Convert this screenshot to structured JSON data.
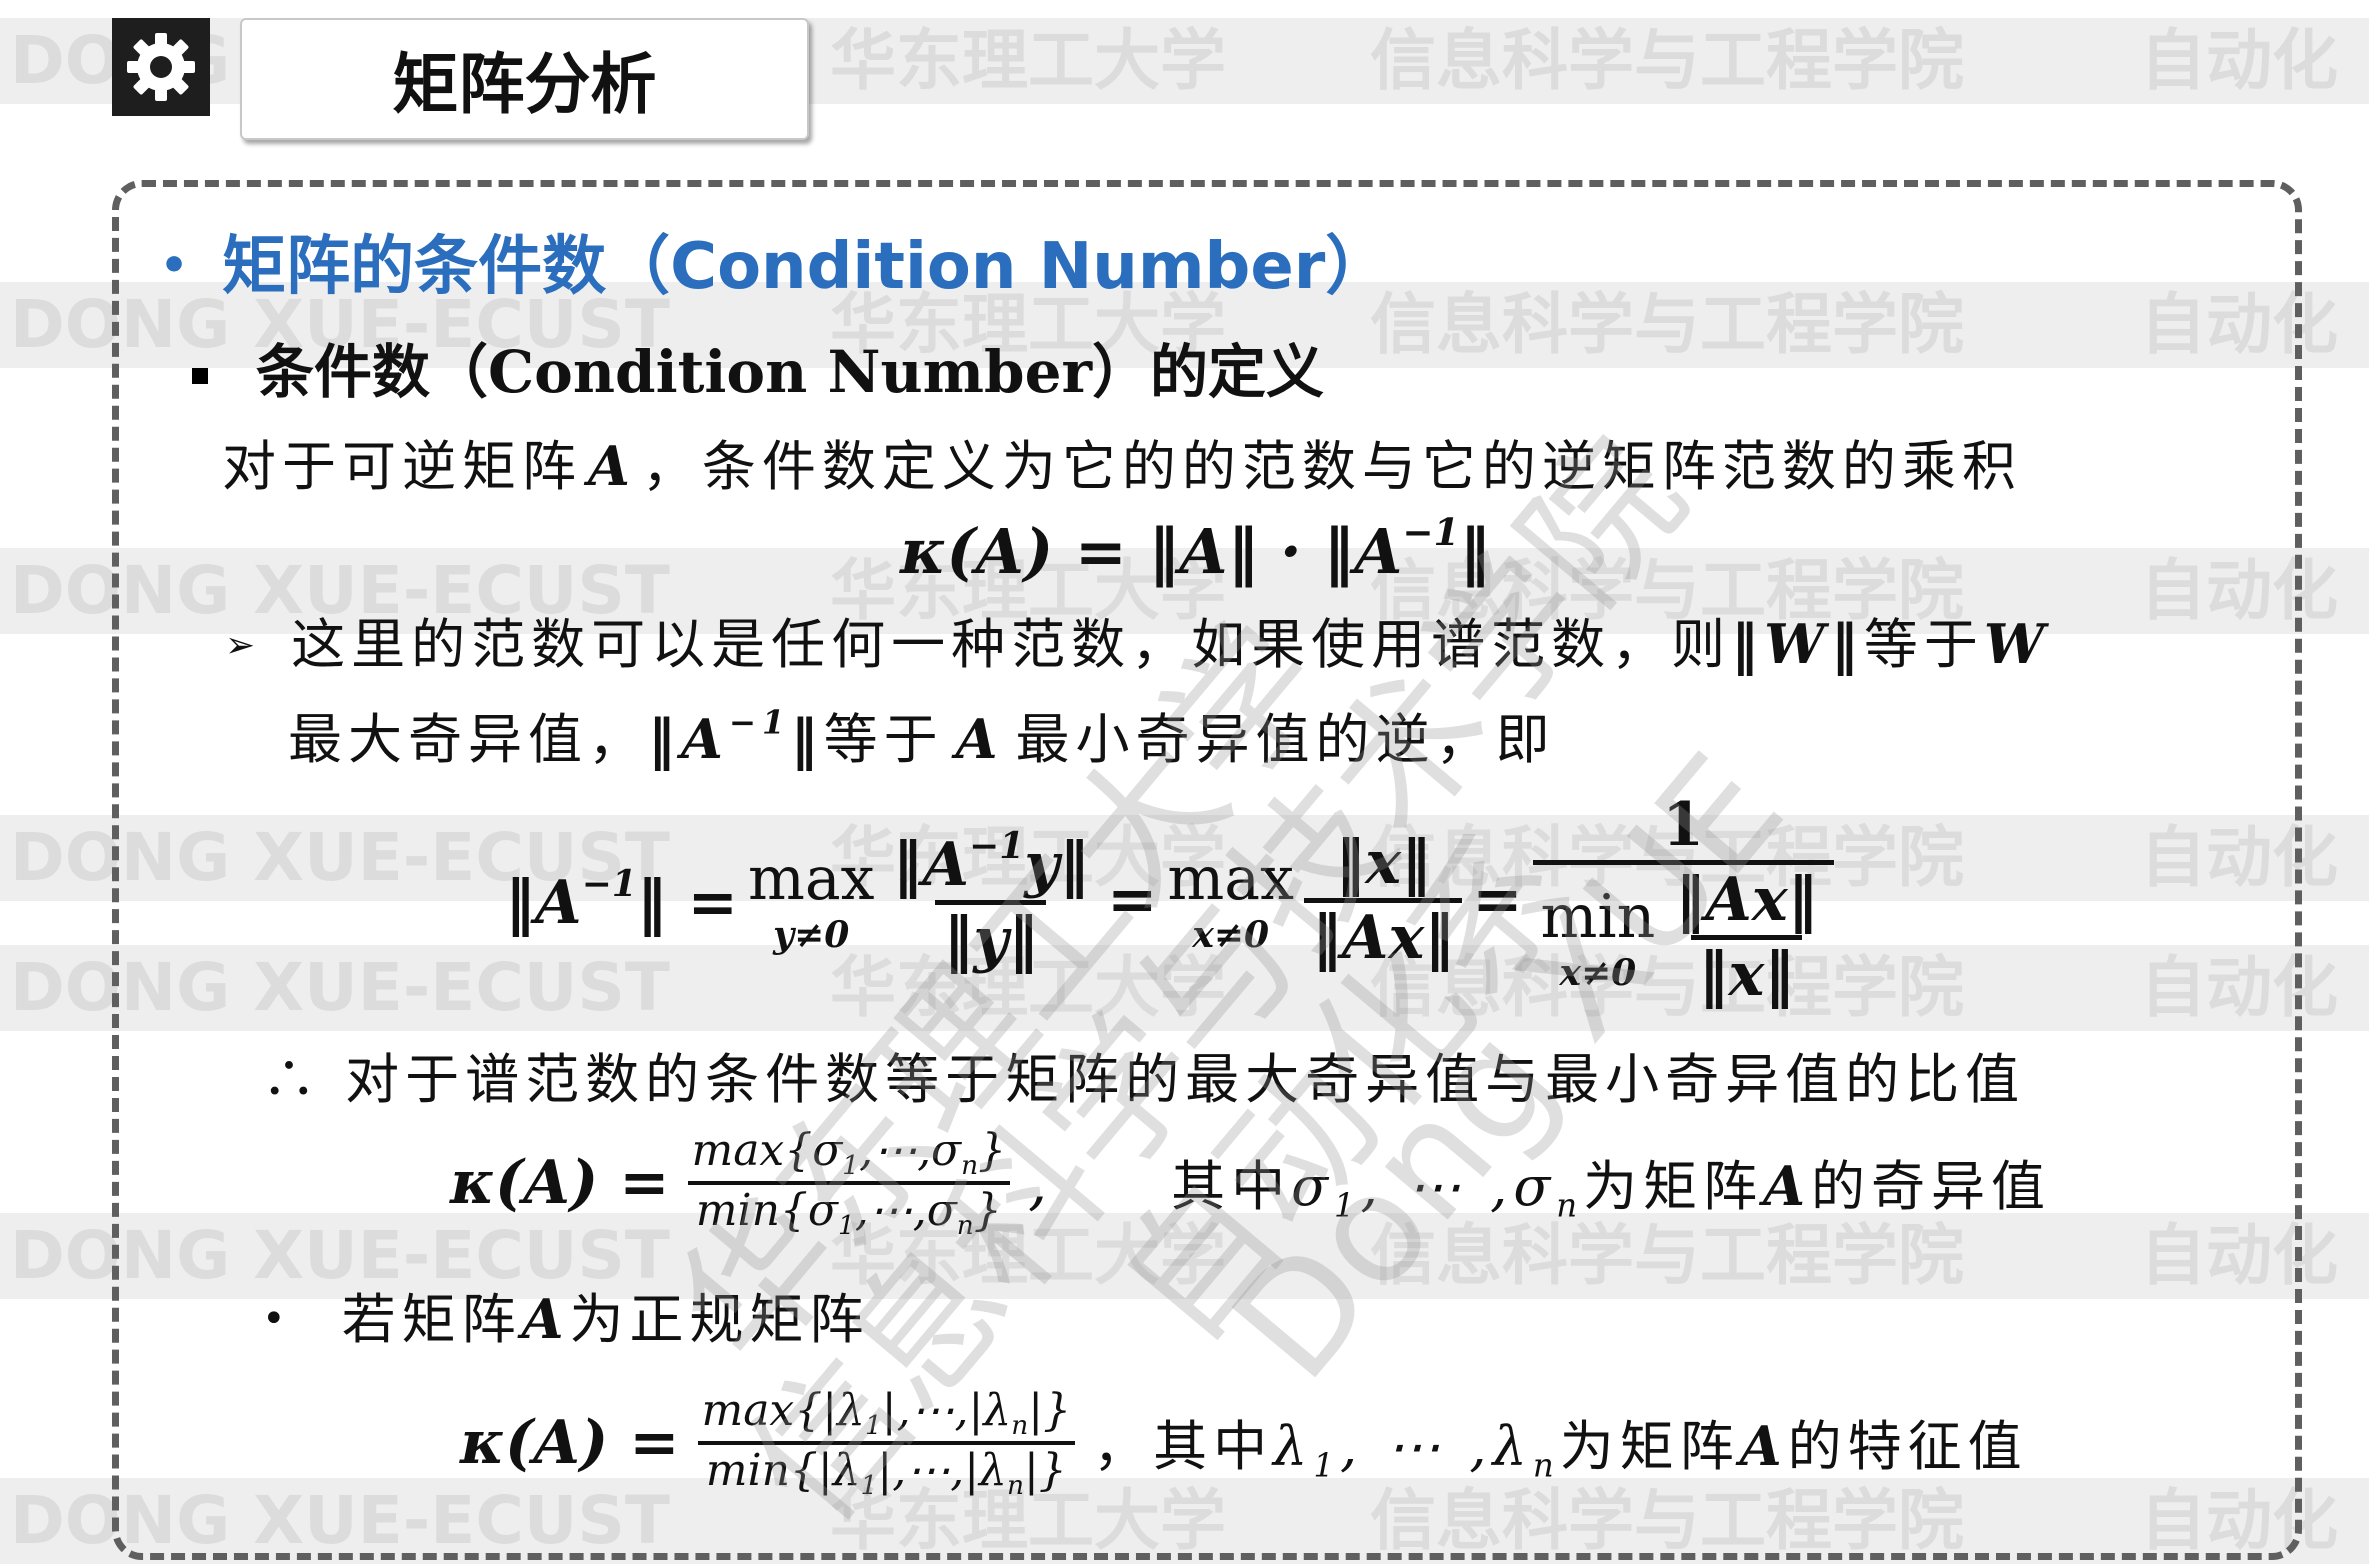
{
  "watermark": {
    "band_texts": [
      "DONG XUE-ECUST",
      "华东理工大学",
      "信息科学与工程学院",
      "自动化"
    ],
    "diag_lines": [
      "华东理工大学",
      "信息科学与技术学院",
      "自动化系",
      "Dong XUE"
    ]
  },
  "header": {
    "gear_icon": "gear-icon",
    "title": "矩阵分析"
  },
  "section": {
    "bullet": "•",
    "heading": "矩阵的条件数（Condition Number）",
    "subheading": "条件数（Condition Number）的定义",
    "intro": "对于可逆矩阵",
    "intro_A": "A",
    "intro_rest": "，条件数定义为它的的范数与它的逆矩阵范数的乘积",
    "def_formula": "κ(A) = ‖A‖ · ‖A",
    "def_formula_sup": "−1",
    "def_formula_end": "‖",
    "note_line1_a": "这里的范数可以是任何一种范数，如果使用谱范数，则",
    "note_line1_b": "‖W‖",
    "note_line1_c": "等于",
    "note_line1_d": "W",
    "note_line2_a": "最大奇异值，",
    "note_line2_b": "‖A",
    "note_line2_sup": "−1",
    "note_line2_c": "‖",
    "note_line2_d": "等于",
    "note_line2_e": "A",
    "note_line2_f": "最小奇异值的逆，即",
    "conclusion": "∴ 对于谱范数的条件数等于矩阵的最大奇异值与最小奇异值的比值",
    "sv_note_a": "其中",
    "sv_note_b": "σ",
    "sv_note_b_sub": "1",
    "sv_note_c": ", ⋯ ,",
    "sv_note_d": "σ",
    "sv_note_d_sub": "n",
    "sv_note_e": "为矩阵",
    "sv_note_f": "A",
    "sv_note_g": "的奇异值",
    "normal_bullet": "•",
    "normal_a": "若矩阵",
    "normal_b": "A",
    "normal_c": "为正规矩阵",
    "eig_note_a": "，其中",
    "eig_note_b": "λ",
    "eig_note_b_sub": "1",
    "eig_note_c": ", ⋯ ,",
    "eig_note_d": "λ",
    "eig_note_d_sub": "n",
    "eig_note_e": "为矩阵",
    "eig_note_f": "A",
    "eig_note_g": "的特征值"
  },
  "formula_inv": {
    "lhs": "‖A",
    "lhs_sup": "−1",
    "lhs_end": "‖ =",
    "max1": "max",
    "max1_lim": "y≠0",
    "num1": "‖A",
    "num1_sup": "−1",
    "num1_end": "y‖",
    "den1": "‖y‖",
    "eq2": "=",
    "max2": "max",
    "max2_lim": "x≠0",
    "num2": "‖x‖",
    "den2": "‖Ax‖",
    "eq3": "=",
    "num3": "1",
    "min3": "min",
    "min3_lim": "x≠0",
    "inner_num": "‖Ax‖",
    "inner_den": "‖x‖"
  },
  "formula_sv": {
    "lhs": "κ(A) =",
    "num": "max{σ",
    "num_s1": "1",
    "num_mid": ",⋯,σ",
    "num_sn": "n",
    "num_end": "}",
    "den": "min{σ",
    "den_s1": "1",
    "den_mid": ",⋯,σ",
    "den_sn": "n",
    "den_end": "}",
    "comma": ","
  },
  "formula_eig": {
    "lhs": "κ(A) =",
    "num": "max{|λ",
    "num_s1": "1",
    "num_mid": "|,⋯,|λ",
    "num_sn": "n",
    "num_end": "|}",
    "den": "min{|λ",
    "den_s1": "1",
    "den_mid": "|,⋯,|λ",
    "den_sn": "n",
    "den_end": "|}"
  }
}
